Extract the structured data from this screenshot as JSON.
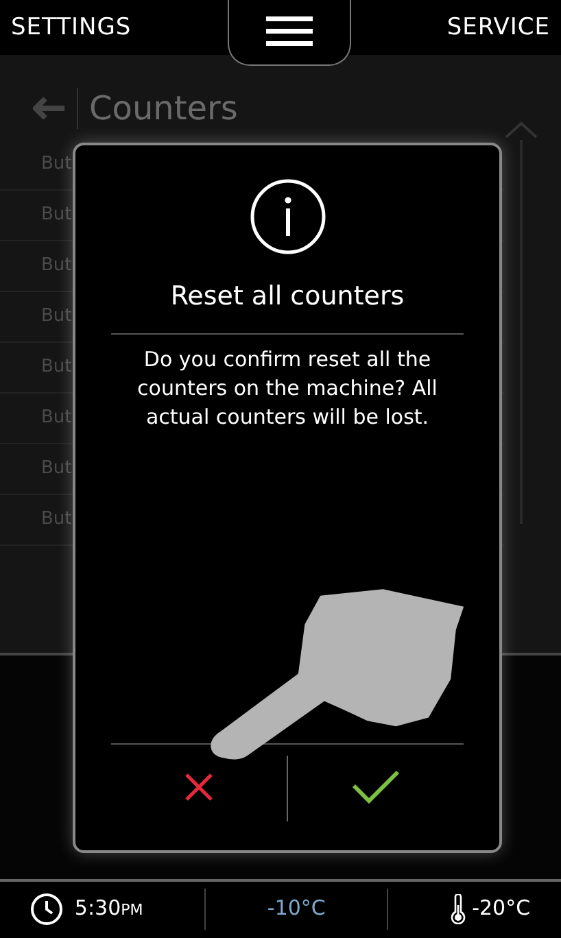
{
  "header": {
    "left": "SETTINGS",
    "right": "SERVICE"
  },
  "page": {
    "title": "Counters",
    "rows": [
      "But",
      "But",
      "But",
      "But",
      "But",
      "But",
      "But",
      "But"
    ]
  },
  "dialog": {
    "title": "Reset all counters",
    "message": "Do you confirm reset all the counters on the machine? All actual counters will be lost.",
    "buttons": [
      {
        "kind": "cancel"
      },
      {
        "kind": "confirm"
      }
    ]
  },
  "status_bar": {
    "time": "5:30",
    "period": "PM",
    "temperature": "-10°C",
    "probe_temperature": "-20°C"
  }
}
